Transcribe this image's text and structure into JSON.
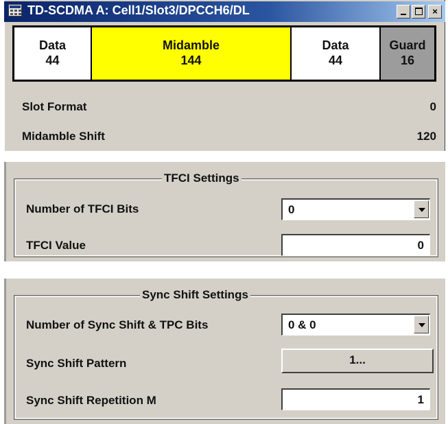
{
  "window": {
    "title": "TD-SCDMA A: Cell1/Slot3/DPCCH6/DL",
    "min_label": "_",
    "close_label": "×"
  },
  "slot_structure": {
    "segments": [
      {
        "name": "Data",
        "value": "44",
        "color": "#ffffff"
      },
      {
        "name": "Midamble",
        "value": "144",
        "color": "#ffff00"
      },
      {
        "name": "Data",
        "value": "44",
        "color": "#ffffff"
      },
      {
        "name": "Guard",
        "value": "16",
        "color": "#9c9c9c"
      }
    ]
  },
  "slot_info": {
    "slot_format_label": "Slot Format",
    "slot_format_value": "0",
    "midamble_shift_label": "Midamble Shift",
    "midamble_shift_value": "120"
  },
  "tfci": {
    "title": "TFCI Settings",
    "bits_label": "Number of TFCI Bits",
    "bits_value": "0",
    "value_label": "TFCI Value",
    "value_value": "0"
  },
  "sync_shift": {
    "title": "Sync Shift Settings",
    "bits_label": "Number of Sync Shift & TPC Bits",
    "bits_value": "0 & 0",
    "pattern_label": "Sync Shift Pattern",
    "pattern_button": "1...",
    "repetition_label": "Sync Shift Repetition M",
    "repetition_value": "1"
  }
}
